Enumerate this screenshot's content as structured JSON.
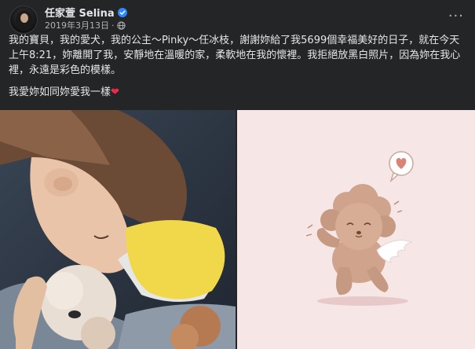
{
  "post": {
    "author_name": "任家萱 Selina",
    "date": "2019年3月13日",
    "separator": "·",
    "more_label": "···",
    "text_p1": "我的寶貝，我的愛犬，我的公主～Pinky～任冰枝，謝謝妳給了我5699個幸福美好的日子，就在今天上午8:21，妳離開了我，安靜地在溫暖的家，柔軟地在我的懷裡。我拒絕放黑白照片，因為妳在我心裡，永遠是彩色的模樣。",
    "text_p2": "我愛妳如同妳愛我一樣",
    "heart_emoji": "❤"
  },
  "colors": {
    "background": "#242526",
    "text_primary": "#e4e6eb",
    "text_secondary": "#b0b3b8",
    "verified_blue": "#2d88ff",
    "heart_red": "#f02849"
  },
  "icons": {
    "verified": "verified-badge-icon",
    "audience": "globe-icon",
    "more": "more-options-icon"
  }
}
